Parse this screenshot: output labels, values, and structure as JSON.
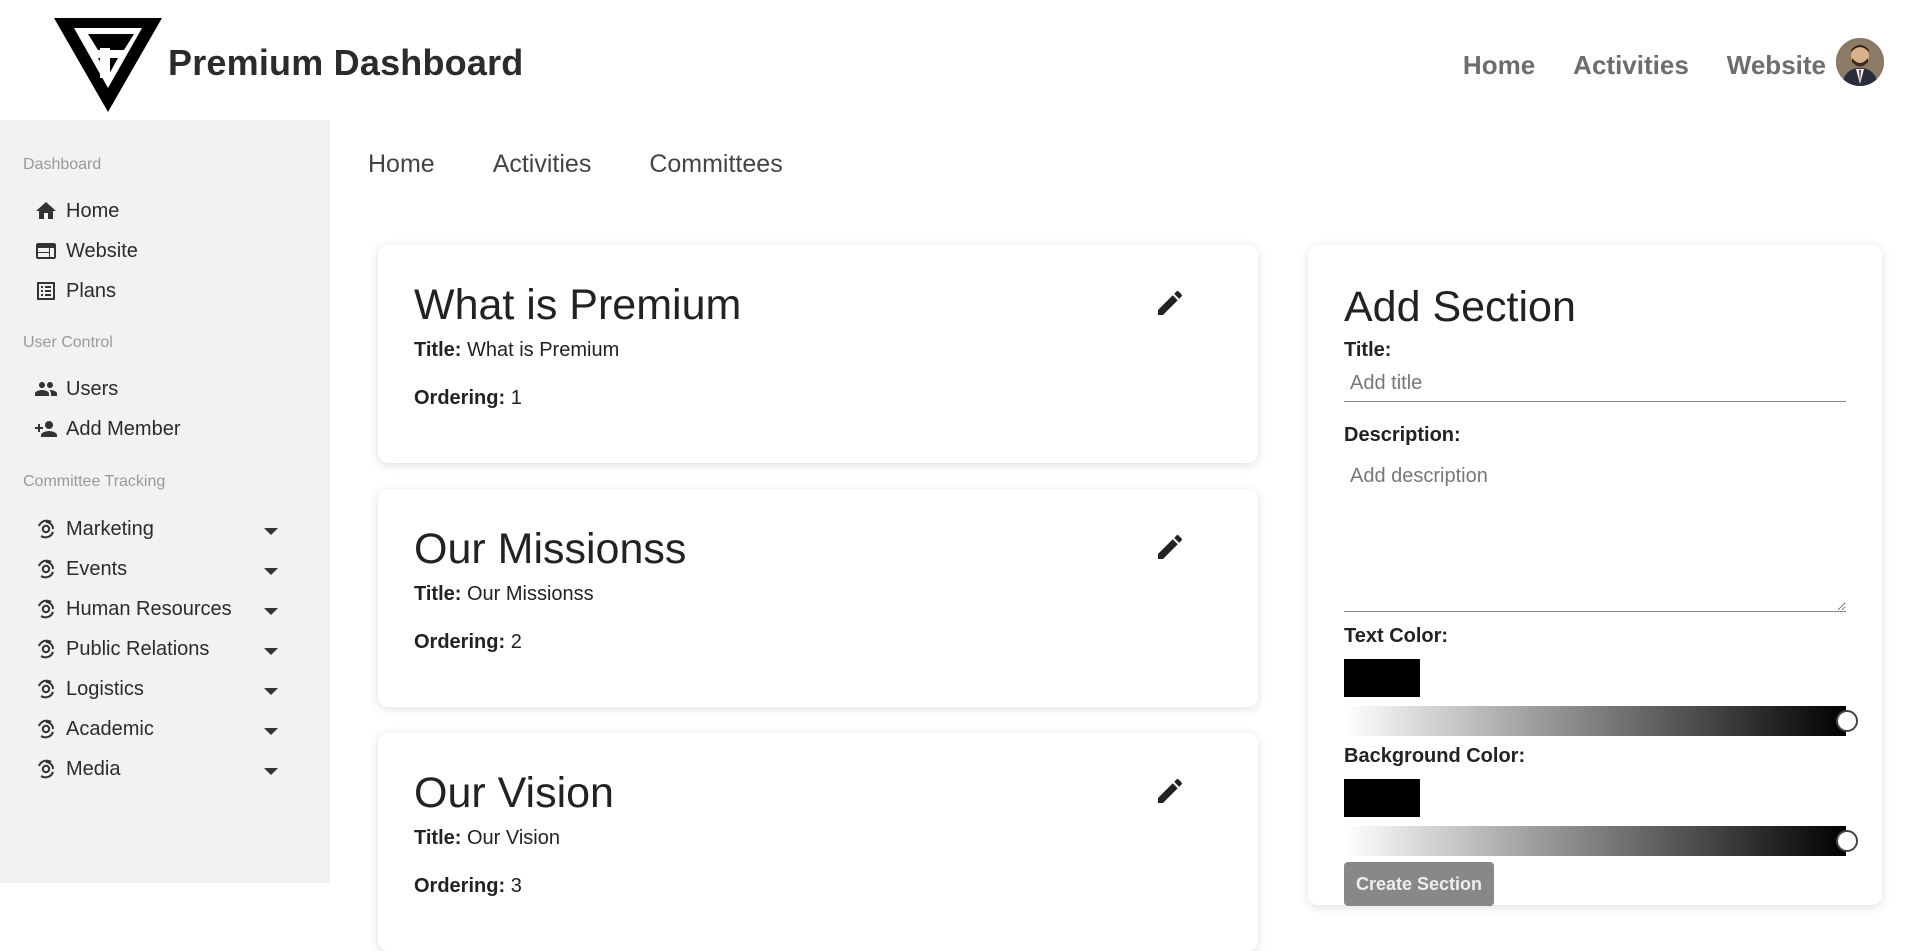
{
  "brand": {
    "name": "Premium Dashboard"
  },
  "topnav": [
    "Home",
    "Activities",
    "Website"
  ],
  "sidebar": {
    "sections": [
      {
        "label": "Dashboard",
        "items": [
          {
            "label": "Home",
            "icon": "home-icon"
          },
          {
            "label": "Website",
            "icon": "web-icon"
          },
          {
            "label": "Plans",
            "icon": "list-icon"
          }
        ]
      },
      {
        "label": "User Control",
        "items": [
          {
            "label": "Users",
            "icon": "users-icon"
          },
          {
            "label": "Add Member",
            "icon": "add-person-icon"
          }
        ]
      },
      {
        "label": "Committee Tracking",
        "items": [
          {
            "label": "Marketing",
            "icon": "committee-icon"
          },
          {
            "label": "Events",
            "icon": "committee-icon"
          },
          {
            "label": "Human Resources",
            "icon": "committee-icon"
          },
          {
            "label": "Public Relations",
            "icon": "committee-icon"
          },
          {
            "label": "Logistics",
            "icon": "committee-icon"
          },
          {
            "label": "Academic",
            "icon": "committee-icon"
          },
          {
            "label": "Media",
            "icon": "committee-icon"
          }
        ]
      }
    ]
  },
  "tabs": [
    "Home",
    "Activities",
    "Committees"
  ],
  "cards": [
    {
      "heading": "What is Premium",
      "title_label": "Title:",
      "title": "What is Premium",
      "ordering_label": "Ordering:",
      "ordering": "1"
    },
    {
      "heading": "Our Missionss",
      "title_label": "Title:",
      "title": "Our Missionss",
      "ordering_label": "Ordering:",
      "ordering": "2"
    },
    {
      "heading": "Our Vision",
      "title_label": "Title:",
      "title": "Our Vision",
      "ordering_label": "Ordering:",
      "ordering": "3"
    }
  ],
  "add_section": {
    "heading": "Add Section",
    "title_label": "Title:",
    "title_placeholder": "Add title",
    "description_label": "Description:",
    "description_placeholder": "Add description",
    "text_color_label": "Text Color:",
    "text_color": "#000000",
    "background_color_label": "Background Color:",
    "background_color": "#000000",
    "create_button": "Create Section"
  },
  "colors": {
    "sidebar_bg": "#f2f2f2",
    "accent_text": "#222222",
    "muted_text": "#9a9a9a",
    "button_bg": "#888888"
  }
}
